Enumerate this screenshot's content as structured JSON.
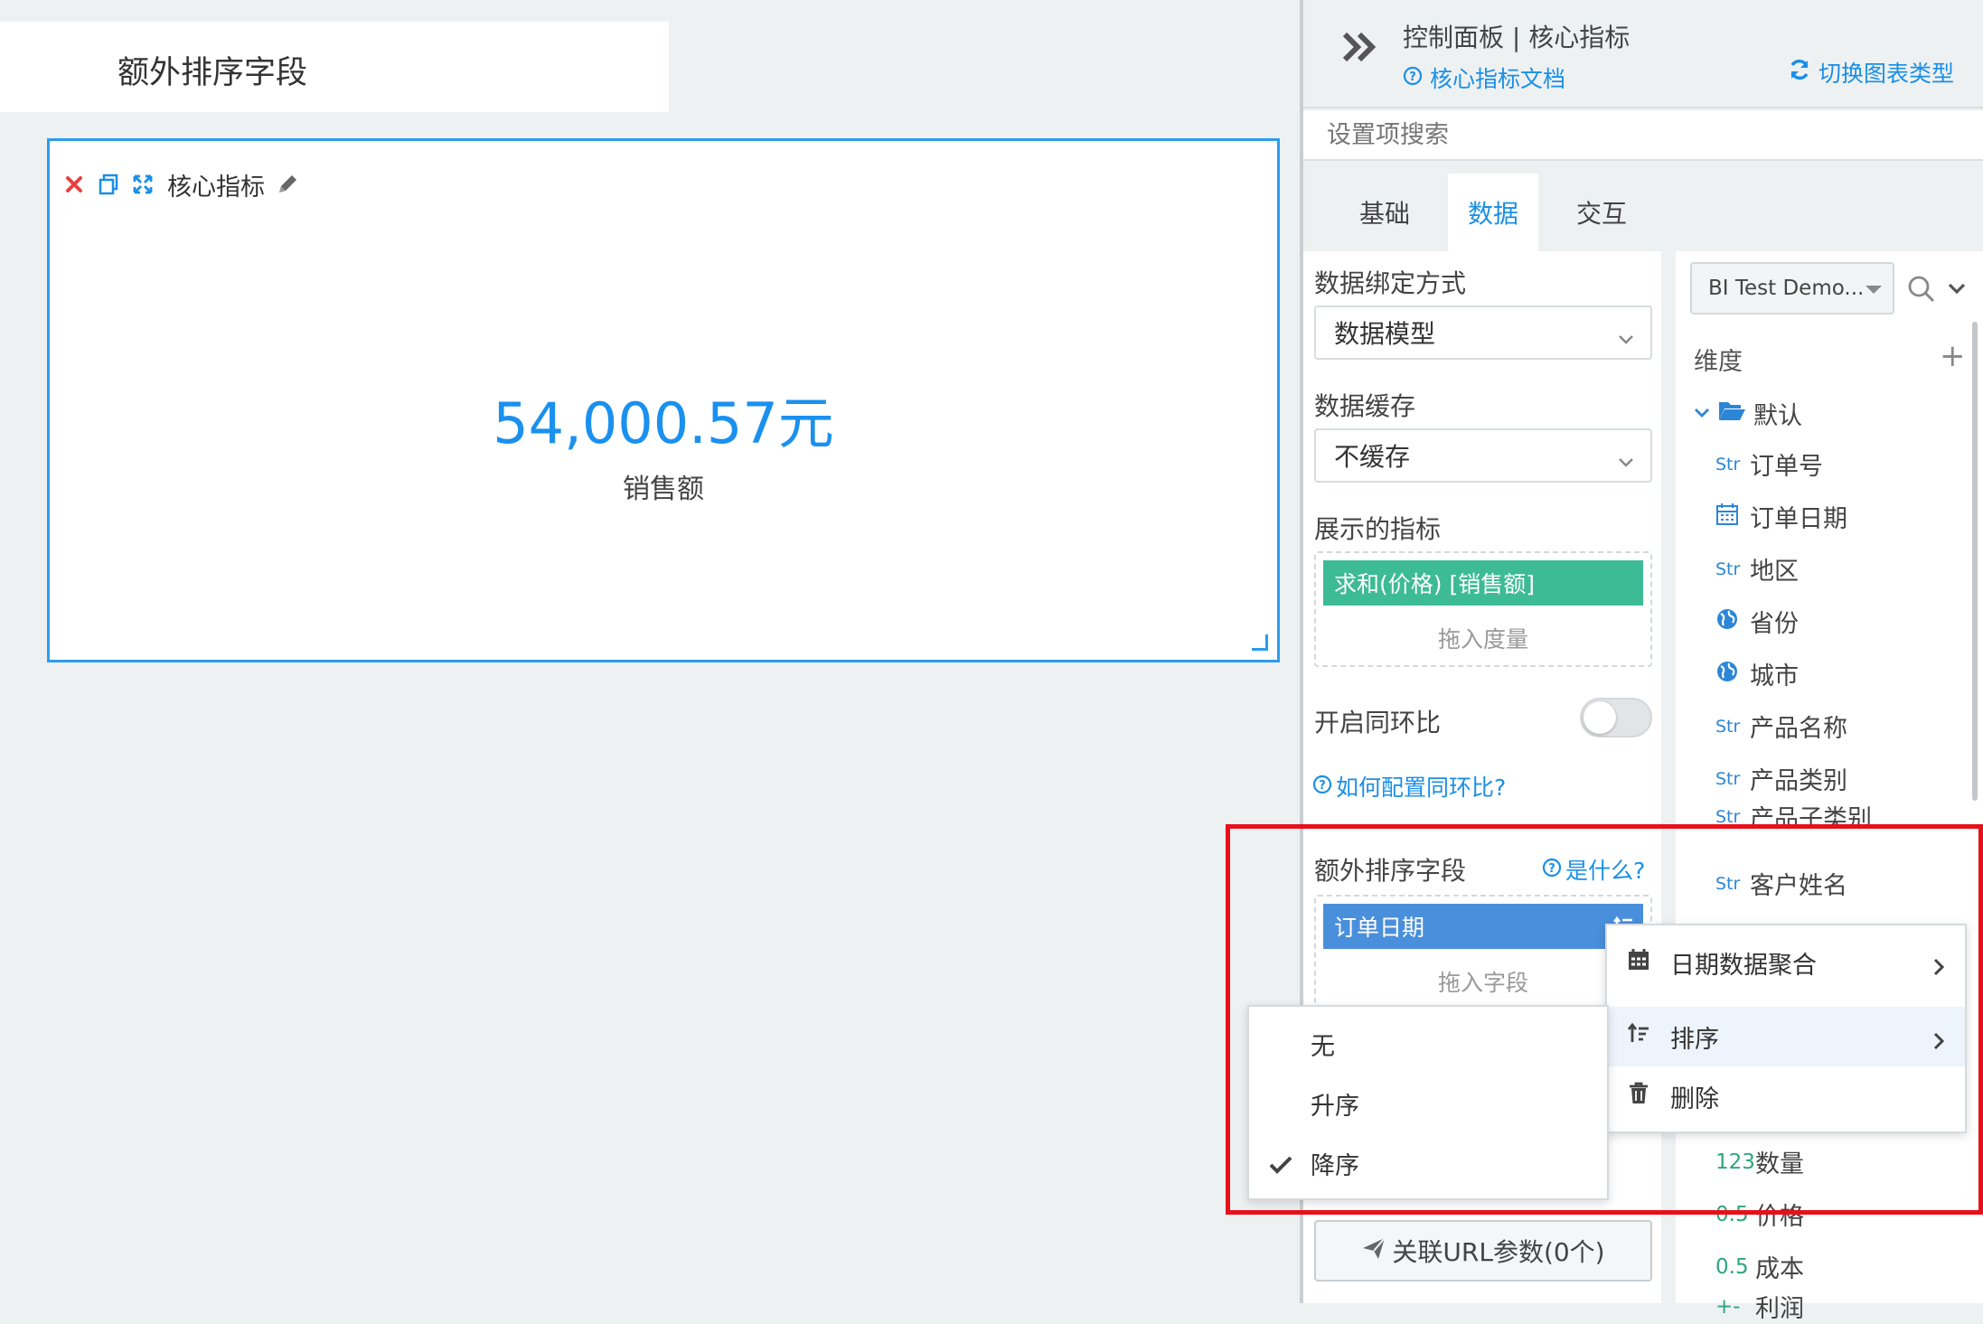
{
  "canvas": {
    "title_box": "额外排序字段",
    "widget": {
      "title": "核心指标",
      "kpi_value": "54,000.57元",
      "kpi_label": "销售额"
    }
  },
  "panel": {
    "header": {
      "title": "控制面板 | 核心指标",
      "doc_link": "核心指标文档",
      "switch_chart": "切换图表类型"
    },
    "search_placeholder": "设置项搜索",
    "tabs": [
      {
        "label": "基础",
        "active": false
      },
      {
        "label": "数据",
        "active": true
      },
      {
        "label": "交互",
        "active": false
      }
    ],
    "config": {
      "binding_label": "数据绑定方式",
      "binding_value": "数据模型",
      "cache_label": "数据缓存",
      "cache_value": "不缓存",
      "metrics_label": "展示的指标",
      "metric_pill": "求和(价格) [销售额]",
      "metric_hint": "拖入度量",
      "yoy_label": "开启同环比",
      "yoy_help": "如何配置同环比?",
      "sort_field_label": "额外排序字段",
      "sort_field_help": "是什么?",
      "sort_field_pill": "订单日期",
      "sort_field_hint": "拖入字段",
      "url_button": "关联URL参数(0个)"
    },
    "fields": {
      "dataset": "BI Test Demo...",
      "dimension_label": "维度",
      "folder": "默认",
      "dimensions": [
        {
          "type": "Str",
          "name": "订单号"
        },
        {
          "type": "date",
          "name": "订单日期"
        },
        {
          "type": "Str",
          "name": "地区"
        },
        {
          "type": "geo",
          "name": "省份"
        },
        {
          "type": "geo",
          "name": "城市"
        },
        {
          "type": "Str",
          "name": "产品名称"
        },
        {
          "type": "Str",
          "name": "产品类别"
        },
        {
          "type": "Str",
          "name": "产品子类别"
        },
        {
          "type": "Str",
          "name": "客户姓名"
        }
      ],
      "measures": [
        {
          "type": "123",
          "name": "数量"
        },
        {
          "type": "0.5",
          "name": "价格"
        },
        {
          "type": "0.5",
          "name": "成本"
        },
        {
          "type": "+-",
          "name": "利润"
        }
      ]
    }
  },
  "context_menu": {
    "items": [
      {
        "icon": "calendar-icon",
        "label": "日期数据聚合",
        "has_submenu": true
      },
      {
        "icon": "sort-icon",
        "label": "排序",
        "has_submenu": true,
        "hover": true
      },
      {
        "icon": "trash-icon",
        "label": "删除",
        "has_submenu": false
      }
    ]
  },
  "sort_menu": {
    "items": [
      {
        "label": "无",
        "checked": false
      },
      {
        "label": "升序",
        "checked": false
      },
      {
        "label": "降序",
        "checked": true
      }
    ]
  },
  "colors": {
    "accent": "#1a8fe6",
    "metric_pill": "#3dbb95",
    "field_pill": "#4a8fdb",
    "highlight": "#e8101a"
  }
}
